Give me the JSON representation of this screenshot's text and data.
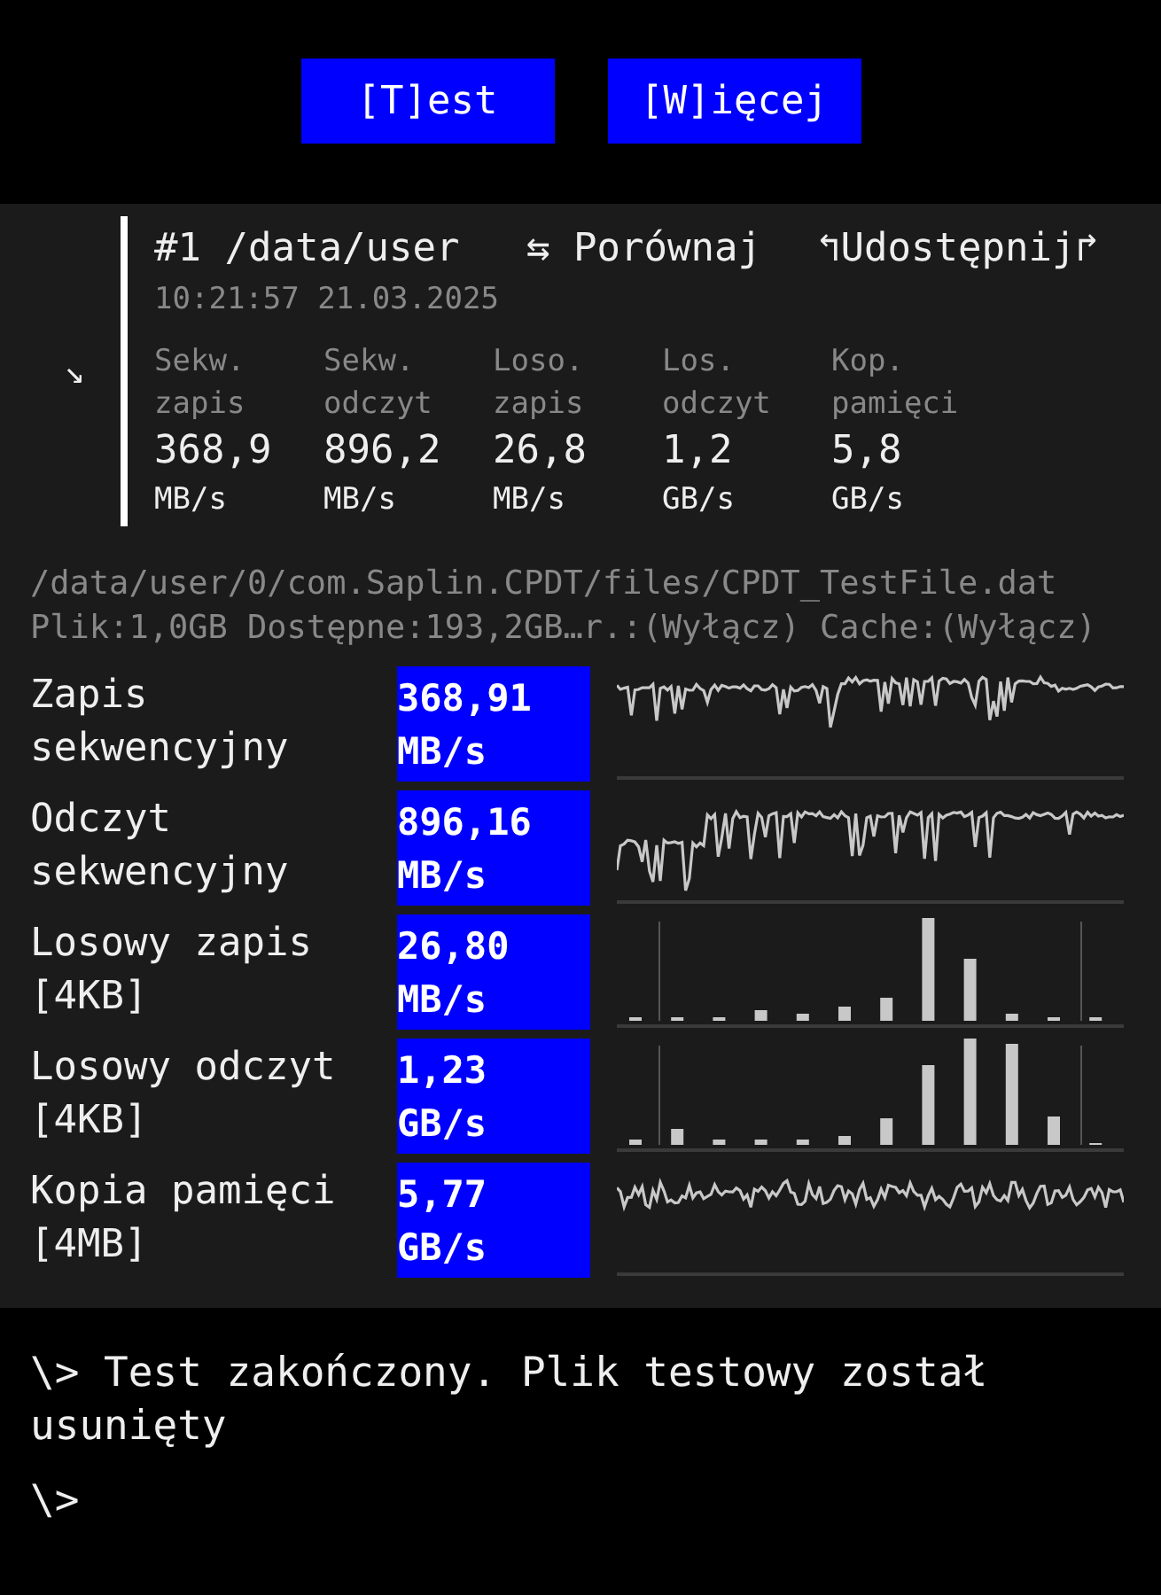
{
  "buttons": [
    {
      "label": "[T]est"
    },
    {
      "label": "[W]ięcej"
    }
  ],
  "result_card": {
    "expand_icon": "↘",
    "title": "#1 /data/user",
    "compare": "⇆ Porównaj",
    "share": "↰Udostępnij↱",
    "timestamp": "10:21:57 21.03.2025",
    "metrics": [
      {
        "label_1": "Sekw.",
        "label_2": "zapis",
        "value": "368,9",
        "unit": "MB/s"
      },
      {
        "label_1": "Sekw.",
        "label_2": "odczyt",
        "value": "896,2",
        "unit": "MB/s"
      },
      {
        "label_1": "Loso.",
        "label_2": "zapis",
        "value": "26,8",
        "unit": "MB/s"
      },
      {
        "label_1": "Los.",
        "label_2": "odczyt",
        "value": "1,2",
        "unit": "GB/s"
      },
      {
        "label_1": "Kop.",
        "label_2": "pamięci",
        "value": "5,8",
        "unit": "GB/s"
      }
    ]
  },
  "file_path": "/data/user/0/com.Saplin.CPDT/files/CPDT_TestFile.dat",
  "file_info": "Plik:1,0GB Dostępne:193,2GB…r.:(Wyłącz) Cache:(Wyłącz)",
  "tests": [
    {
      "label_1": "Zapis",
      "label_2": "sekwencyjny",
      "value": "368,91",
      "unit": "MB/s",
      "graph": {
        "kind": "line"
      }
    },
    {
      "label_1": "Odczyt",
      "label_2": "sekwencyjny",
      "value": "896,16",
      "unit": "MB/s",
      "graph": {
        "kind": "line"
      }
    },
    {
      "label_1": "Losowy zapis",
      "label_2": "[4KB]",
      "value": "26,80",
      "unit": "MB/s",
      "graph": {
        "kind": "histogram"
      }
    },
    {
      "label_1": "Losowy odczyt",
      "label_2": "[4KB]",
      "value": "1,23",
      "unit": "GB/s",
      "graph": {
        "kind": "histogram"
      }
    },
    {
      "label_1": "Kopia pamięci",
      "label_2": "[4MB]",
      "value": "5,77",
      "unit": "GB/s",
      "graph": {
        "kind": "line"
      }
    }
  ],
  "console": [
    {
      "prompt": "\\>",
      "text": "Test zakończony. Plik testowy został usunięty"
    },
    {
      "prompt": "\\>"
    }
  ]
}
